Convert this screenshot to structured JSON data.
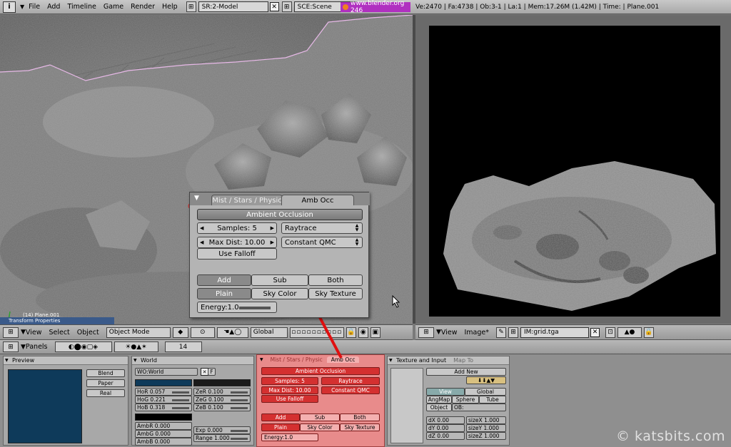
{
  "top_bar": {
    "menus": [
      "File",
      "Add",
      "Timeline",
      "Game",
      "Render",
      "Help"
    ],
    "screen": "SR:2-Model",
    "scene": "SCE:Scene",
    "url": "www.blender.org 246",
    "stats": "Ve:2470 | Fa:4738 | Ob:3-1 | La:1  | Mem:17.26M (1.42M) | Time:   | Plane.001"
  },
  "viewport": {
    "object_label": "(14) Plane.001",
    "transform_header": "Transform Properties"
  },
  "view3d_header": {
    "menus": [
      "View",
      "Select",
      "Object"
    ],
    "mode": "Object Mode",
    "orientation": "Global"
  },
  "image_header": {
    "menus": [
      "View",
      "Image*"
    ],
    "image_name": "IM:grid.tga"
  },
  "buttons_header": {
    "label": "Panels",
    "frame": "14"
  },
  "popup": {
    "tab_inactive": "Mist / Stars / Physic",
    "tab_active": "Amb Occ",
    "header": "Ambient Occlusion",
    "samples": "Samples: 5",
    "method": "Raytrace",
    "max_dist": "Max Dist: 10.00",
    "sampling": "Constant QMC",
    "falloff": "Use Falloff",
    "blend_add": "Add",
    "blend_sub": "Sub",
    "blend_both": "Both",
    "color_plain": "Plain",
    "color_sky": "Sky Color",
    "color_tex": "Sky Texture",
    "energy": "Energy:1.0"
  },
  "preview_panel": {
    "title": "Preview",
    "buttons": [
      "Blend",
      "Paper",
      "Real"
    ]
  },
  "world_panel": {
    "title": "World",
    "name": "WO:World",
    "fake": "F",
    "hor": [
      "HoR 0.057",
      "HoG 0.221",
      "HoB 0.318"
    ],
    "zen": [
      "ZeR 0.100",
      "ZeG 0.100",
      "ZeB 0.100"
    ],
    "amb": [
      "AmbR 0.000",
      "AmbG 0.000",
      "AmbB 0.000"
    ],
    "exp": "Exp 0.000",
    "range": "Range 1.000"
  },
  "texture_panel": {
    "tab_active": "Texture and Input",
    "tab_inactive": "Map To",
    "add_new": "Add New",
    "view": "View",
    "global": "Global",
    "angmap": "AngMap",
    "sphere": "Sphere",
    "tube": "Tube",
    "object": "Object",
    "ob": "OB:",
    "dx": "dX 0.00",
    "dy": "dY 0.00",
    "dz": "dZ 0.00",
    "sx": "sizeX 1.000",
    "sy": "sizeY 1.000",
    "sz": "sizeZ 1.000"
  },
  "watermark": "© katsbits.com",
  "colors": {
    "ao_highlight": "#e88b8b",
    "ao_red_button": "#d43030",
    "world_horizon": "#0e3a5a",
    "url_bg": "#b030c0"
  }
}
